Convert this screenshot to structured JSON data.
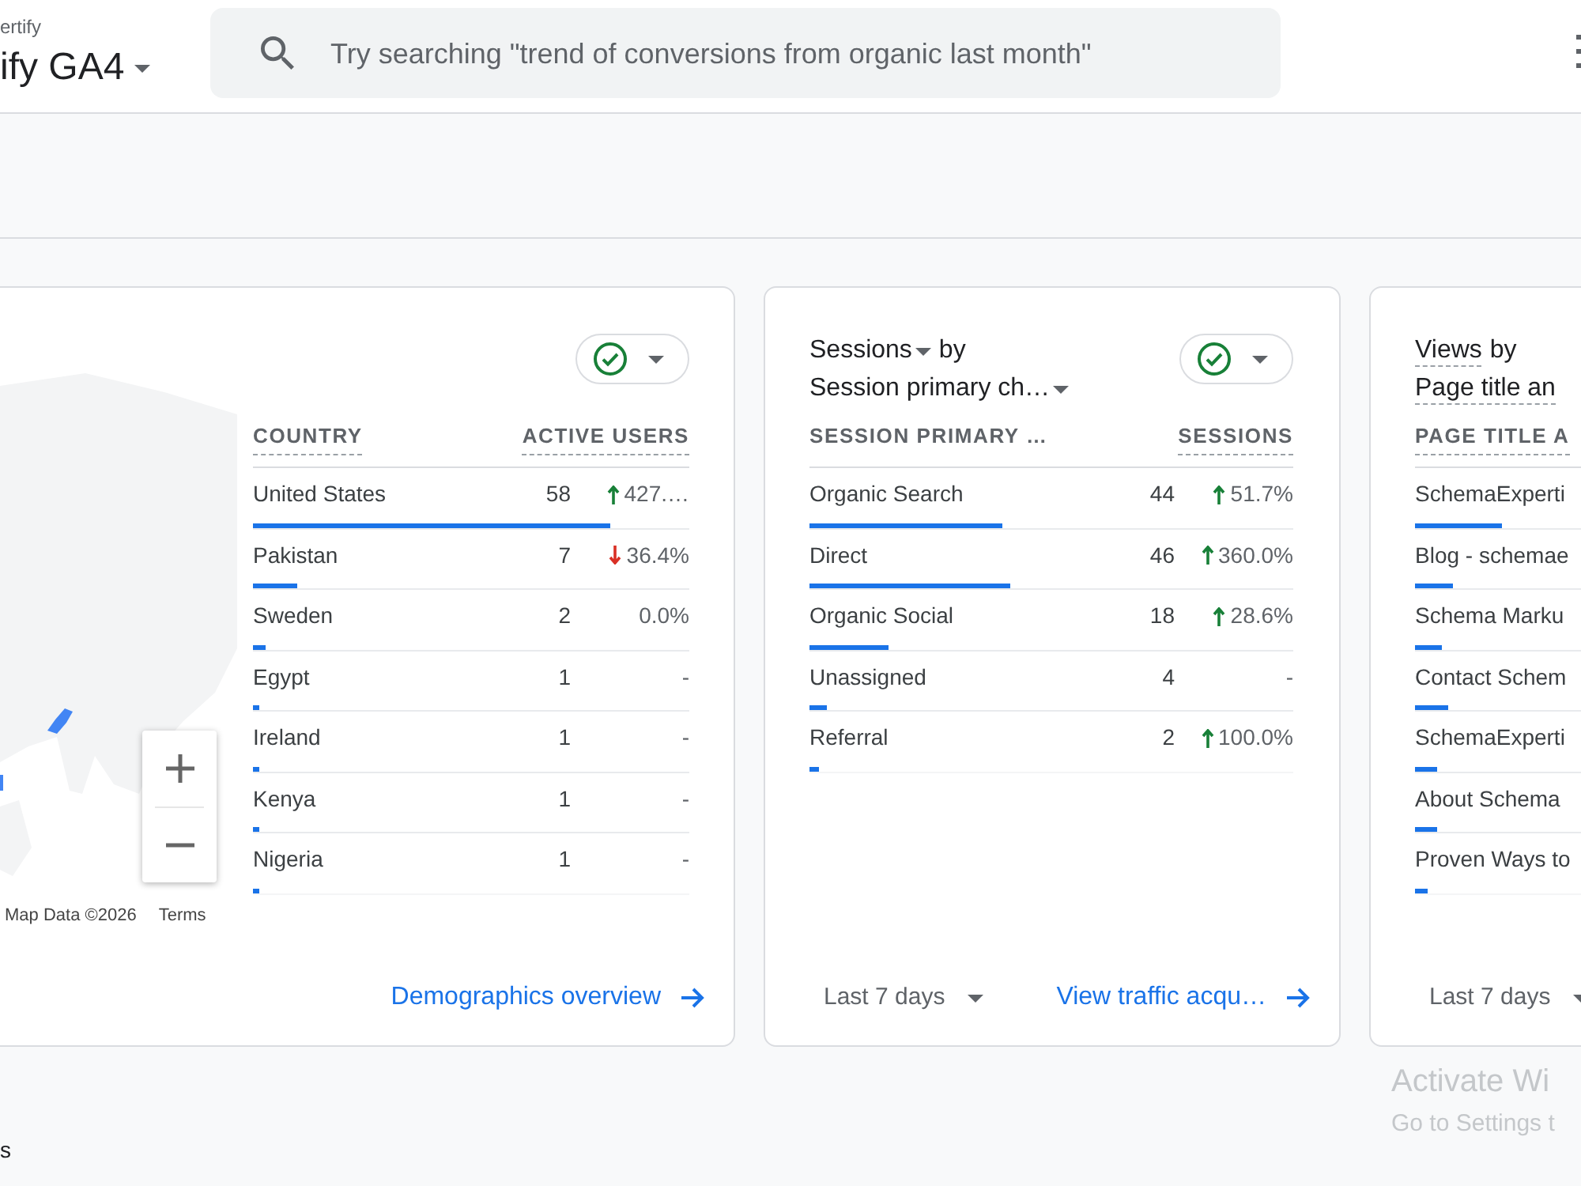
{
  "header": {
    "account": "ertify",
    "property": "ify GA4",
    "search": {
      "placeholder": "Try searching \"trend of conversions from organic last month\""
    }
  },
  "cards": [
    {
      "map": {
        "attribution": "Map Data ©2026",
        "terms": "Terms"
      },
      "chip": {
        "checked": true
      },
      "columns": [
        {
          "label": "COUNTRY",
          "underlined": true
        },
        {
          "label": "ACTIVE USERS",
          "underlined": true
        }
      ],
      "rows": [
        {
          "kind": "rise",
          "name": "United States",
          "value": "58",
          "change": "427.…",
          "level": 0.82
        },
        {
          "kind": "fall",
          "name": "Pakistan",
          "value": "7",
          "change": "36.4%",
          "level": 0.1
        },
        {
          "kind": "flat",
          "name": "Sweden",
          "value": "2",
          "change": "0.0%",
          "level": 0.028
        },
        {
          "kind": "flat",
          "name": "Egypt",
          "value": "1",
          "change": "-",
          "level": 0.014
        },
        {
          "kind": "flat",
          "name": "Ireland",
          "value": "1",
          "change": "-",
          "level": 0.014
        },
        {
          "kind": "flat",
          "name": "Kenya",
          "value": "1",
          "change": "-",
          "level": 0.014
        },
        {
          "kind": "flat",
          "name": "Nigeria",
          "value": "1",
          "change": "-",
          "level": 0.014
        }
      ],
      "footer": {
        "link": "Demographics overview"
      }
    },
    {
      "title": {
        "metric": {
          "text": "Sessions",
          "kind": "dropdown"
        },
        "joiner": "by",
        "dimension": {
          "text": "Session primary ch…",
          "kind": "dropdown"
        }
      },
      "chip": {
        "checked": true
      },
      "columns": [
        {
          "label": "SESSION PRIMARY …",
          "underlined": false
        },
        {
          "label": "SESSIONS",
          "underlined": true
        }
      ],
      "rows": [
        {
          "kind": "rise",
          "name": "Organic Search",
          "value": "44",
          "change": "51.7%",
          "level": 0.4
        },
        {
          "kind": "rise",
          "name": "Direct",
          "value": "46",
          "change": "360.0%",
          "level": 0.415
        },
        {
          "kind": "rise",
          "name": "Organic Social",
          "value": "18",
          "change": "28.6%",
          "level": 0.163
        },
        {
          "kind": "flat",
          "name": "Unassigned",
          "value": "4",
          "change": "-",
          "level": 0.036
        },
        {
          "kind": "rise",
          "name": "Referral",
          "value": "2",
          "change": "100.0%",
          "level": 0.018
        }
      ],
      "footer": {
        "date_range": "Last 7 days",
        "link": "View traffic acqu…"
      }
    },
    {
      "title": {
        "metric": {
          "text": "Views",
          "kind": "underlined"
        },
        "joiner": "by",
        "dimension": {
          "text": "Page title an",
          "kind": "underlined"
        }
      },
      "columns": [
        {
          "label": "PAGE TITLE A",
          "underlined": true
        }
      ],
      "rows": [
        {
          "name": "SchemaExperti",
          "level": 0.18
        },
        {
          "name": "Blog - schemae",
          "level": 0.08
        },
        {
          "name": "Schema Marku",
          "level": 0.055
        },
        {
          "name": "Contact Schem",
          "level": 0.07
        },
        {
          "name": "SchemaExperti",
          "level": 0.045
        },
        {
          "name": "About Schema",
          "level": 0.045
        },
        {
          "name": "Proven Ways to",
          "level": 0.025
        }
      ],
      "footer": {
        "date_range": "Last 7 days"
      }
    }
  ],
  "page_label": "s",
  "os_notice": {
    "title": "Activate Wi",
    "text": "Go to Settings t"
  }
}
